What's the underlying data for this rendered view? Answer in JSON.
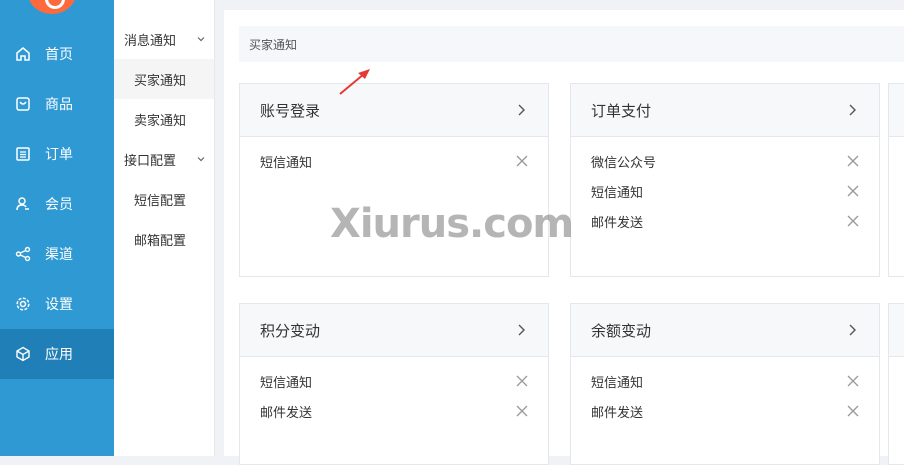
{
  "sidebar": {
    "items": [
      {
        "label": "首页",
        "icon": "home-icon"
      },
      {
        "label": "商品",
        "icon": "bag-icon"
      },
      {
        "label": "订单",
        "icon": "list-icon"
      },
      {
        "label": "会员",
        "icon": "user-icon"
      },
      {
        "label": "渠道",
        "icon": "share-icon"
      },
      {
        "label": "设置",
        "icon": "gear-icon"
      },
      {
        "label": "应用",
        "icon": "cube-icon",
        "active": true
      }
    ]
  },
  "subnav": {
    "groups": [
      {
        "label": "消息通知",
        "items": [
          "买家通知",
          "卖家通知"
        ]
      },
      {
        "label": "接口配置",
        "items": [
          "短信配置",
          "邮箱配置"
        ]
      }
    ],
    "active_item": "买家通知"
  },
  "breadcrumb": "买家通知",
  "cards": [
    {
      "title": "账号登录",
      "items": [
        "短信通知"
      ]
    },
    {
      "title": "订单支付",
      "items": [
        "微信公众号",
        "短信通知",
        "邮件发送"
      ]
    },
    {
      "title": "积分变动",
      "items": [
        "短信通知",
        "邮件发送"
      ]
    },
    {
      "title": "余额变动",
      "items": [
        "短信通知",
        "邮件发送"
      ]
    }
  ],
  "watermark": "Xiurus.com",
  "colors": {
    "sidebar": "#2f99d4",
    "sidebar_active": "#1f7fb6",
    "pointer": "#e53935"
  }
}
